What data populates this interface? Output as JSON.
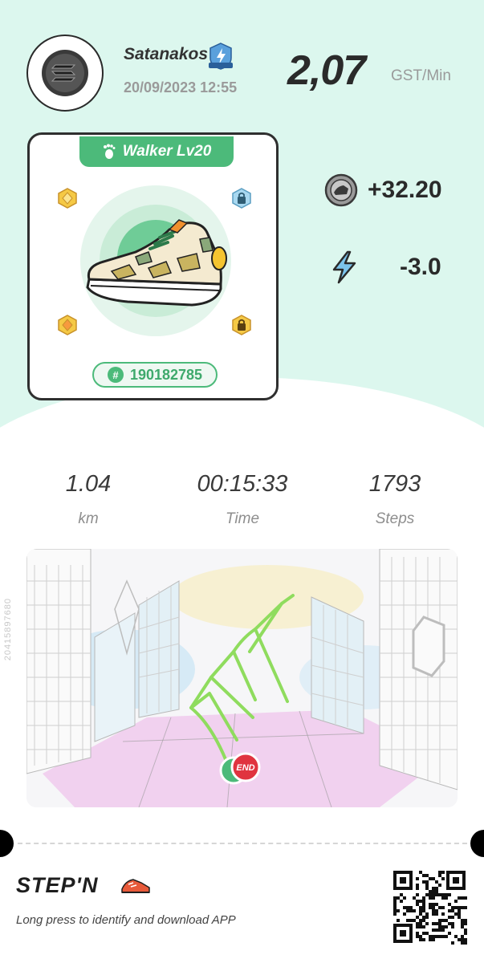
{
  "profile": {
    "username": "Satanakos",
    "datetime": "20/09/2023 12:55",
    "avatar_icon": "solana-logo-icon",
    "badge_icon": "lightning-shield-badge-icon"
  },
  "rate": {
    "value": "2,07",
    "unit": "GST/Min"
  },
  "sneaker_card": {
    "level_label": "Walker Lv20",
    "id": "190182785",
    "sockets": [
      "gem-socket-icon",
      "lock-socket-icon",
      "gem-socket-icon",
      "lock-socket-icon"
    ]
  },
  "earnings": {
    "gst_earned": "+32.20",
    "energy_used": "-3.0"
  },
  "metrics": [
    {
      "value": "1.04",
      "label": "km"
    },
    {
      "value": "00:15:33",
      "label": "Time"
    },
    {
      "value": "1793",
      "label": "Steps"
    }
  ],
  "side_code": "20415897680",
  "route": {
    "end_label": "END",
    "route_color": "#8fdc5e"
  },
  "footer": {
    "brand": "STEP'N",
    "tagline": "Long press to identify and download APP"
  },
  "colors": {
    "mint_bg": "#dcf7ee",
    "accent_green": "#4cba7a",
    "end_red": "#e0343f"
  }
}
